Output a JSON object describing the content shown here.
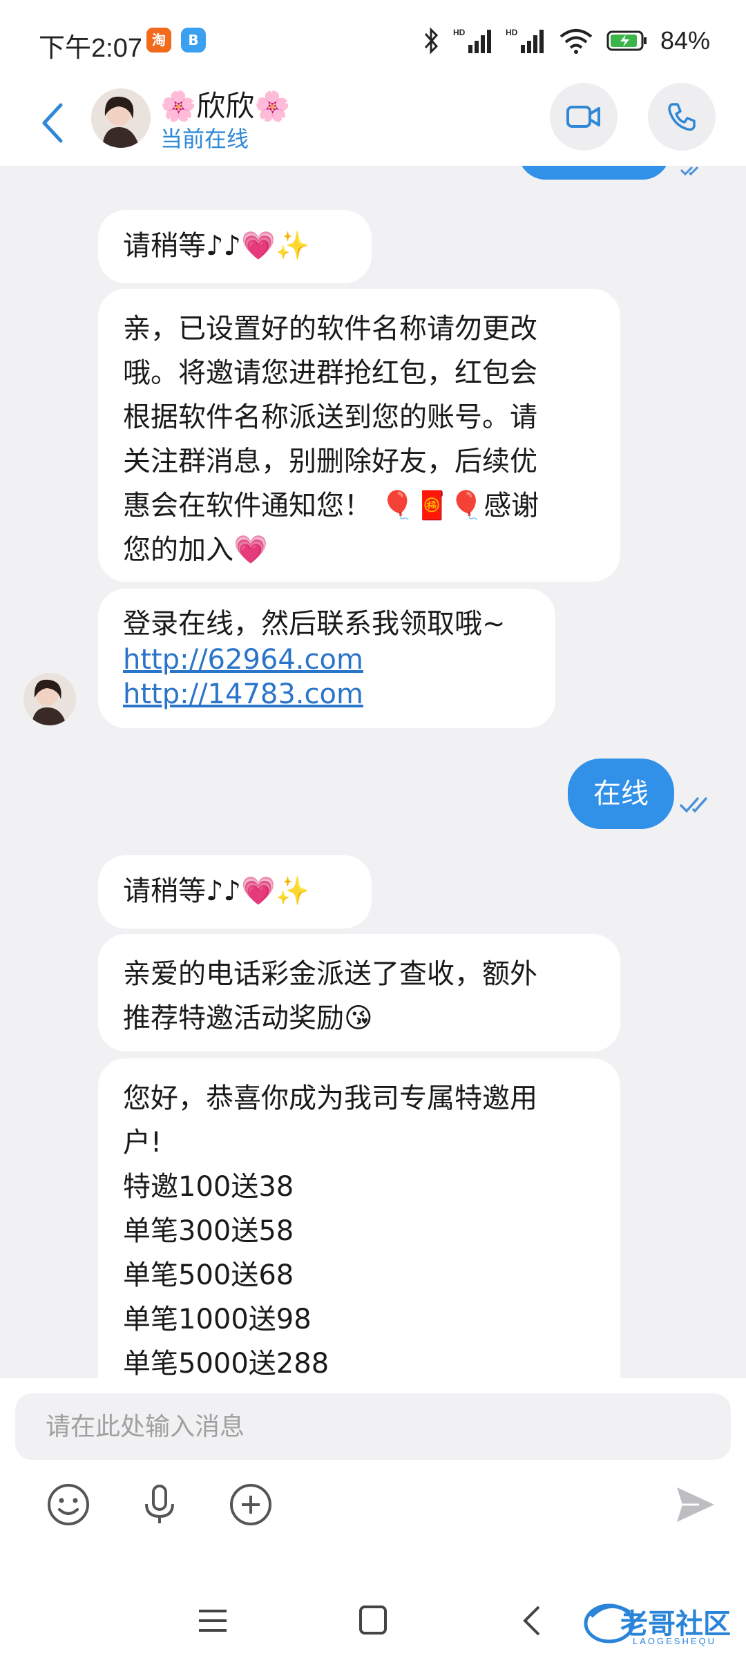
{
  "status_bar": {
    "time": "下午2:07",
    "app_icon_1": "淘",
    "app_icon_2": "B",
    "battery": "84%",
    "icons": [
      "taobao-icon",
      "app-b-icon",
      "bluetooth-icon",
      "signal-hd-icon",
      "signal-hd-icon",
      "wifi-icon",
      "battery-icon"
    ]
  },
  "header": {
    "contact_name": "🌸欣欣🌸",
    "status": "当前在线",
    "colors": {
      "status": "#2f88d6",
      "accent": "#3190e8"
    }
  },
  "messages": [
    {
      "side": "in",
      "text": "请稍等♪♪💗✨"
    },
    {
      "side": "in",
      "text_lines": [
        "亲，已设置好的软件名称请勿更改",
        "哦。将邀请您进群抢红包，红包会",
        "根据软件名称派送到您的账号。请",
        "关注群消息，别删除好友，后续优",
        "惠会在软件通知您！ 🎈🧧🎈感谢",
        "您的加入💗"
      ]
    },
    {
      "side": "in",
      "text": "登录在线，然后联系我领取哦~",
      "links": [
        "http://62964.com",
        "http://14783.com"
      ]
    },
    {
      "side": "out",
      "text": "在线",
      "status": "read"
    },
    {
      "side": "in",
      "text": "请稍等♪♪💗✨"
    },
    {
      "side": "in",
      "text_lines": [
        "亲爱的电话彩金派送了查收，额外",
        "推荐特邀活动奖励😘"
      ]
    },
    {
      "side": "in",
      "text_lines": [
        "您好，恭喜你成为我司专属特邀用",
        "户!",
        "特邀100送38",
        "单笔300送58",
        "单笔500送68",
        "单笔1000送98",
        "单笔5000送288"
      ]
    }
  ],
  "input": {
    "placeholder": "请在此处输入消息"
  },
  "toolbar": [
    "emoji-icon",
    "mic-icon",
    "add-icon",
    "send-icon"
  ],
  "watermark": {
    "text": "老哥社区",
    "subtext": "LAOGESHEQU"
  }
}
